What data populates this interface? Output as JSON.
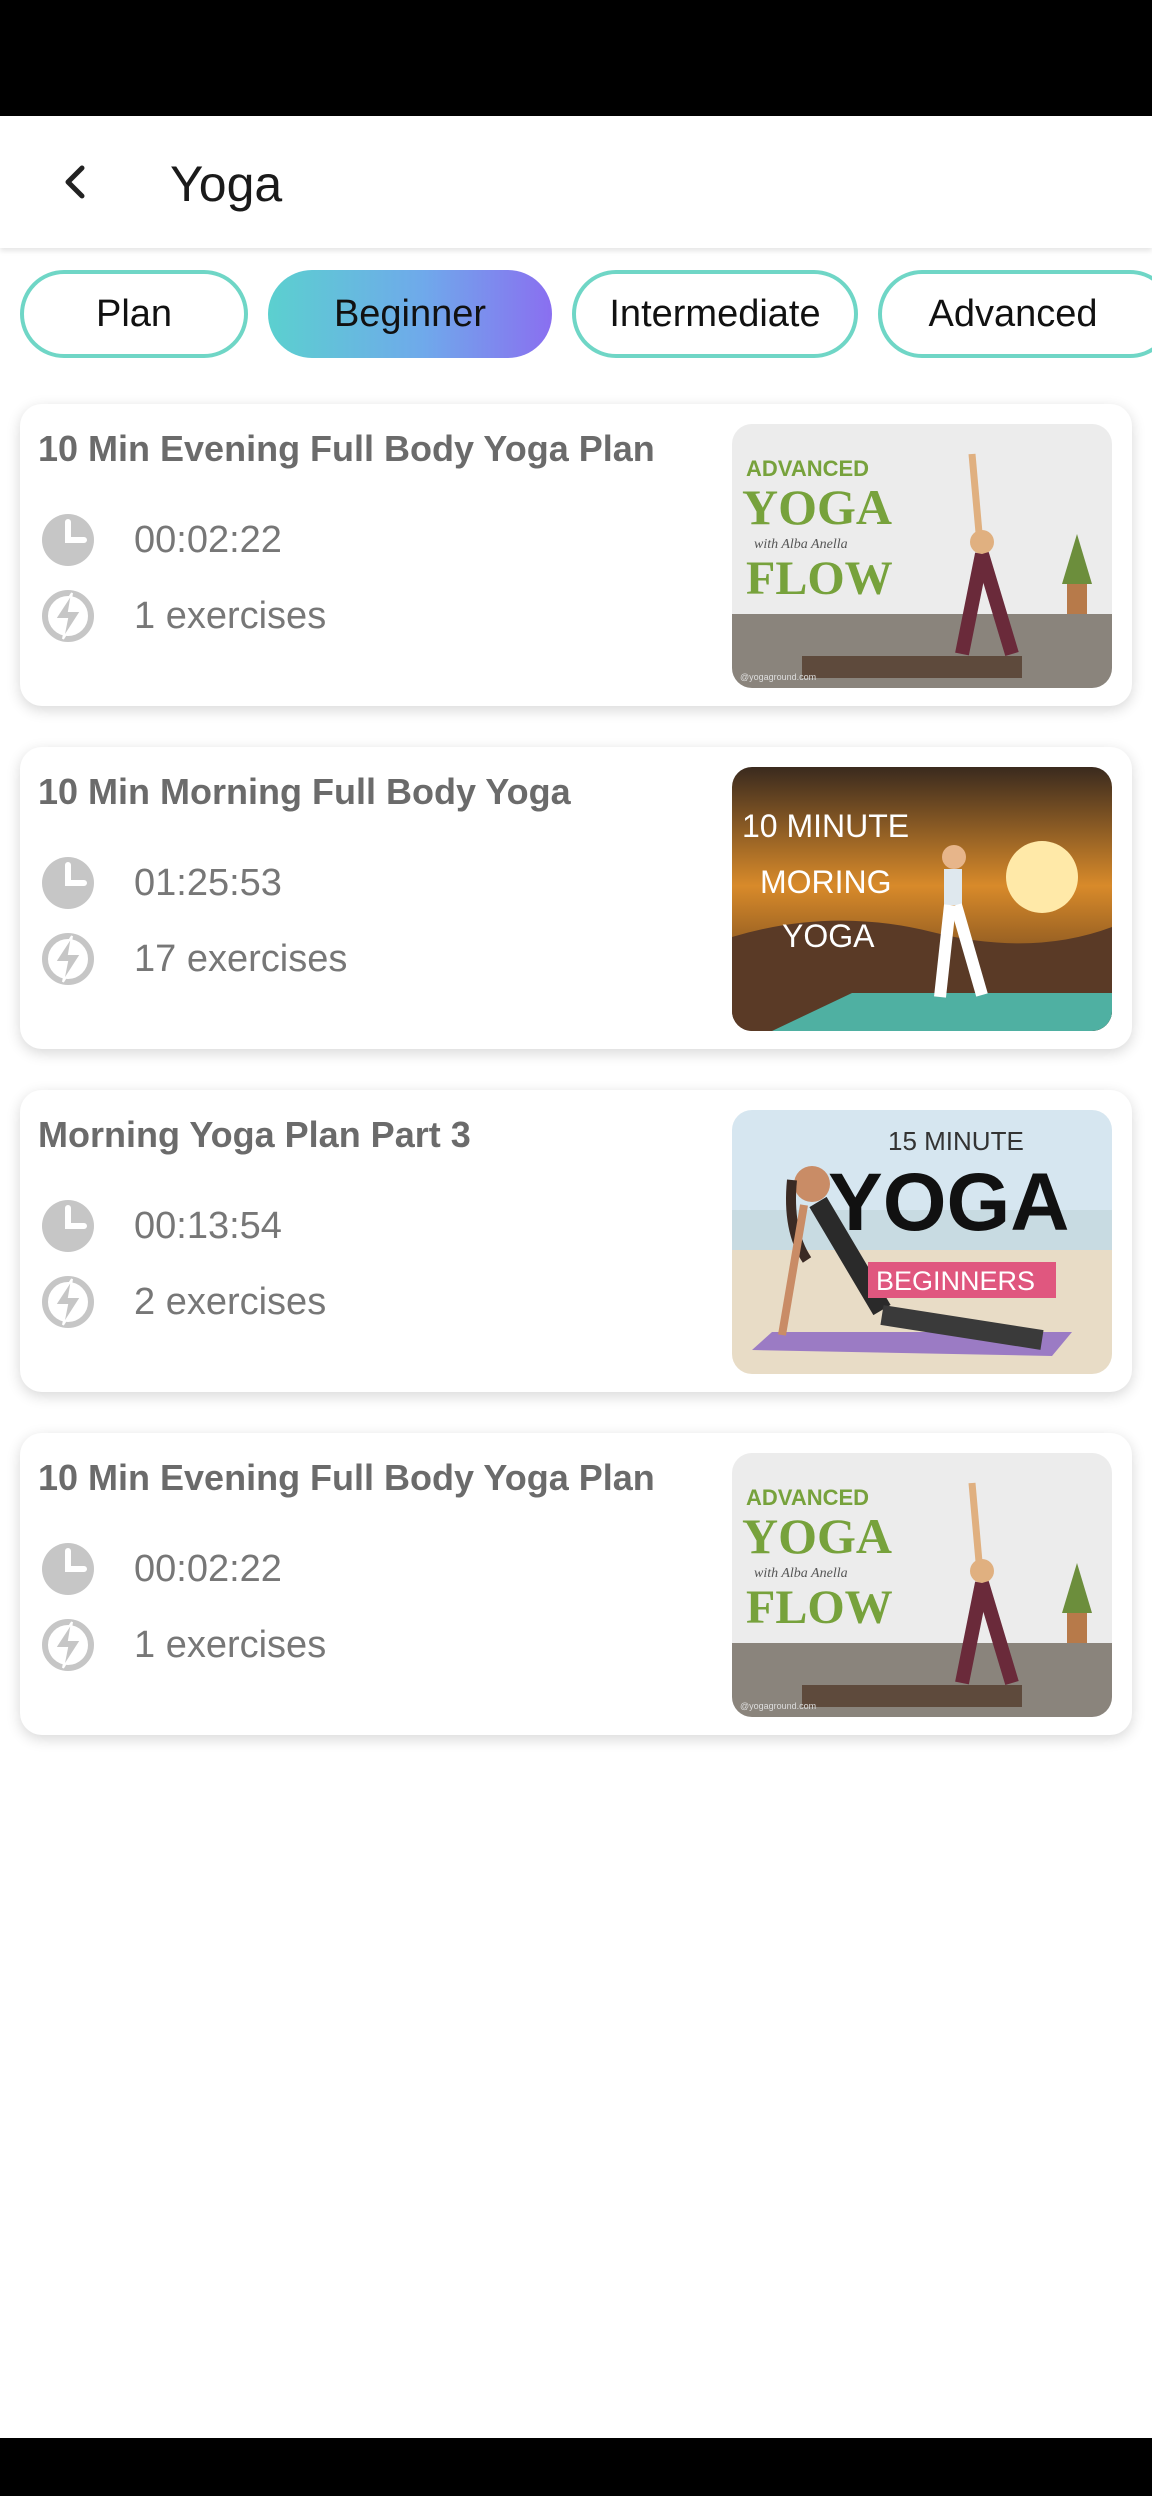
{
  "app_bar": {
    "title": "Yoga"
  },
  "tabs": [
    {
      "label": "Plan",
      "active": false
    },
    {
      "label": "Beginner",
      "active": true
    },
    {
      "label": "Intermediate",
      "active": false
    },
    {
      "label": "Advanced",
      "active": false
    }
  ],
  "cards": [
    {
      "title": "10 Min Evening Full Body Yoga Plan",
      "duration": "00:02:22",
      "exercises": "1 exercises",
      "thumb": {
        "line1": "ADVANCED",
        "line2": "YOGA",
        "line3": "with Alba Anella",
        "line4": "FLOW",
        "footer": "@yogaground.com"
      }
    },
    {
      "title": "10 Min Morning Full Body Yoga",
      "duration": "01:25:53",
      "exercises": "17 exercises",
      "thumb": {
        "line1": "10  MINUTE",
        "line2": "MORING",
        "line3": "YOGA"
      }
    },
    {
      "title": "Morning Yoga Plan Part 3",
      "duration": "00:13:54",
      "exercises": "2 exercises",
      "thumb": {
        "line1": "15 MINUTE",
        "line2": "YOGA",
        "line3": "BEGINNERS"
      }
    },
    {
      "title": "10 Min Evening Full Body Yoga Plan",
      "duration": "00:02:22",
      "exercises": "1 exercises",
      "thumb": {
        "line1": "ADVANCED",
        "line2": "YOGA",
        "line3": "with Alba Anella",
        "line4": "FLOW",
        "footer": "@yogaground.com"
      }
    }
  ],
  "icons": {
    "back": "arrow-back-icon",
    "duration": "clock-icon",
    "exercises": "lightning-bolt-icon"
  },
  "colors": {
    "tab_border": "#6fd6c6",
    "tab_active_start": "#5bd0cf",
    "tab_active_end": "#8a6ff0",
    "card_title": "#6b6b6b",
    "meta_text": "#777777"
  }
}
